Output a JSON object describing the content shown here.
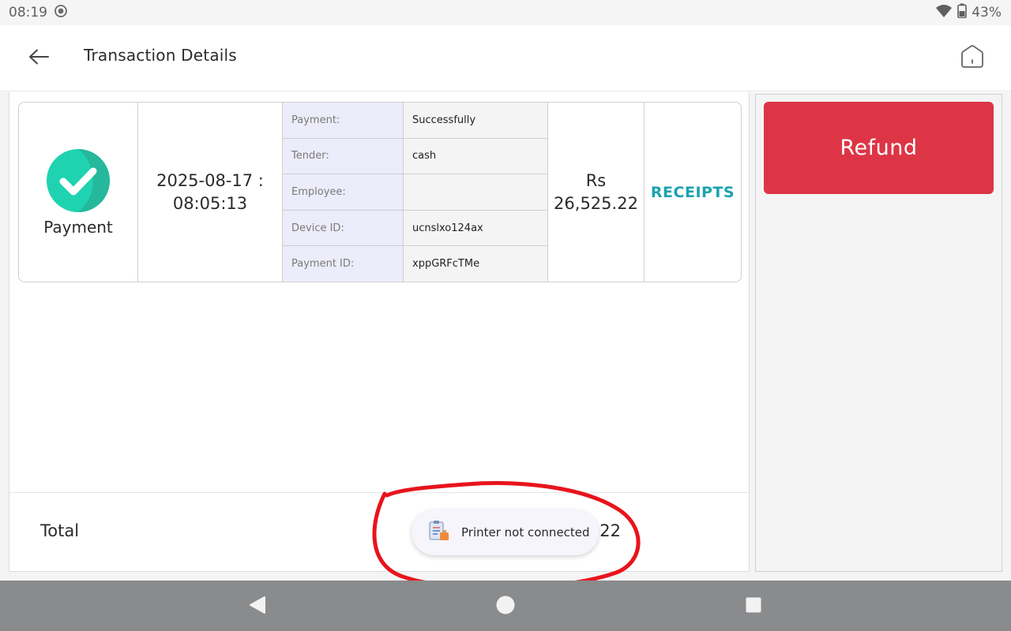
{
  "status_bar": {
    "time": "08:19",
    "battery": "43%"
  },
  "app_bar": {
    "title": "Transaction Details"
  },
  "transaction": {
    "type_label": "Payment",
    "datetime_line1": "2025-08-17 :",
    "datetime_line2": "08:05:13",
    "details": [
      {
        "key": "Payment:",
        "value": "Successfully"
      },
      {
        "key": "Tender:",
        "value": "cash"
      },
      {
        "key": "Employee:",
        "value": ""
      },
      {
        "key": "Device ID:",
        "value": "ucnslxo124ax"
      },
      {
        "key": "Payment ID:",
        "value": "xppGRFcTMe"
      }
    ],
    "amount_currency": "Rs",
    "amount_value": "26,525.22",
    "receipts_label": "RECEIPTS"
  },
  "total": {
    "label": "Total",
    "visible_amount": ".22"
  },
  "refund_button": {
    "label": "Refund",
    "color": "#dd3546"
  },
  "toast": {
    "message": "Printer not connected",
    "icon": "clipboard-icon"
  },
  "colors": {
    "accent_teal": "#1aa3b0",
    "success_green": "#1fd3b0",
    "annotation_red": "#e8141c"
  }
}
